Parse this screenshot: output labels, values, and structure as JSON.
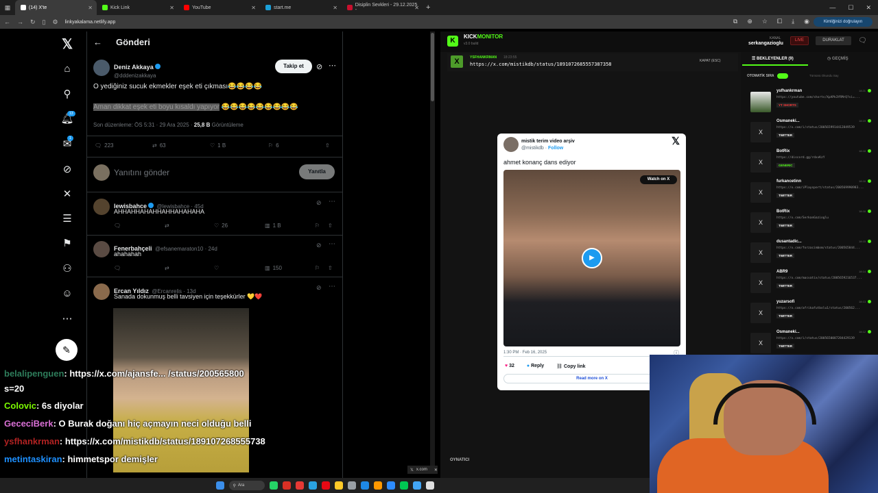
{
  "browser": {
    "tabs": [
      {
        "title": "(14) X'te",
        "color": "#ffffff",
        "active": true
      },
      {
        "title": "Kick Link",
        "color": "#53fc18",
        "active": false
      },
      {
        "title": "YouTube",
        "color": "#ff0000",
        "active": false
      },
      {
        "title": "start.me",
        "color": "#1ba0d8",
        "active": false
      },
      {
        "title": "Disiplin Sevkleri - 29.12.2025 -",
        "color": "#c8102e",
        "active": false
      }
    ],
    "url": "linkyakalama.netlify.app",
    "verify_label": "Kimliğinizi doğrulayın"
  },
  "x": {
    "header_title": "Gönderi",
    "nav_badges": {
      "notifications": "13",
      "messages": "1"
    },
    "post": {
      "author": "Deniz Akkaya",
      "handle": "@dddenizakkaya",
      "follow_label": "Takip et",
      "line1": "O yediğiniz sucuk ekmekler eşek eti çıkması😂😂😂😂",
      "line2_highlight": "Aman dikkat eşek eti boyu kısaldı yapıyor",
      "line2_rest": " 😂😂😂😂😂😂😂😂😂",
      "edited": "Son düzenleme: ÖS 5:31 · 29 Ara 2025 ·",
      "views_count": "25,8 B",
      "views_label": "Görüntüleme",
      "replies": "223",
      "reposts": "63",
      "likes": "1 B",
      "bookmarks": "6"
    },
    "reply_placeholder": "Yanıtını gönder",
    "reply_button": "Yanıtla",
    "replies": [
      {
        "name": "lewisbahce",
        "handle": "@lewisbahce · 45d",
        "text": "AHHAHHAHAHHAHHAHAHAHA",
        "likes": "26",
        "views": "1 B"
      },
      {
        "name": "Fenerbahçeli",
        "handle": "@efsanemaraton10 · 24d",
        "text": "ahahahah",
        "likes": "",
        "views": "150"
      },
      {
        "name": "Ercan Yıldız",
        "handle": "@Ercanrelis · 13d",
        "text": "Sanada dokunmuş belli tavsiyen için teşekkürler 💛❤️"
      }
    ]
  },
  "chat": [
    {
      "user": "belalipenguen",
      "msg": ": https://x.com/ajansfe... /status/200565800",
      "color": "#2e7d5b"
    },
    {
      "user": "",
      "msg": "s=20",
      "color": "#ffffff"
    },
    {
      "user": "Colovic",
      "msg": ": 6s diyolar",
      "color": "#7cfc00"
    },
    {
      "user": "GececiBerk",
      "msg": ": O Burak doğanı hiç açmayın neci olduğu belli",
      "color": "#da70d6"
    },
    {
      "user": "ysfhankrman",
      "msg": ": https://x.com/mistikdb/status/18910726855573​8",
      "color": "#b22222"
    },
    {
      "user": "metintaskiran",
      "msg": ": himmetspor demişler",
      "color": "#1e90ff"
    }
  ],
  "kick": {
    "title_a": "KICK",
    "title_b": "MONITOR",
    "version": "v3.0 build",
    "kanal_label": "KANAL",
    "channel": "serkangazioglu",
    "live_label": "LIVE",
    "pause_label": "DURAKLAT",
    "current": {
      "user": "YSFHANKRMAN",
      "time": "18:23:55",
      "url": "https://x.com/mistikdb/status/1891072685557387358",
      "close": "KAPAT (ESC)"
    },
    "tab_pending": "BEKLEYENLER (9)",
    "tab_history": "GEÇMİŞ",
    "auto_label": "OTOMATİK SIRA",
    "clear_label": "Tümünü Okundu Say",
    "player_label": "OYNATICI",
    "xcom_tab": "x.com",
    "queue": [
      {
        "name": "ysfhankrman",
        "url": "https://youtube.com/shorts/XpAPk3YRMrQ?si=...",
        "tag": "YT SHORTS",
        "tag_color": "#ff3b3b",
        "time": "18:21"
      },
      {
        "name": "Osmaneki...",
        "url": "https://x.com/i/status/2005659914412849539",
        "tag": "TWITTER",
        "tag_color": "#ffffff",
        "time": "18:19"
      },
      {
        "name": "BotRix",
        "url": "https://discord.gg/rdxvKzY",
        "tag": "GENERIC",
        "tag_color": "#53fc18",
        "time": "18:18"
      },
      {
        "name": "furkancetinn",
        "url": "https://x.com/iPlaysport/status/200569990983...",
        "tag": "TWITTER",
        "tag_color": "#ffffff",
        "time": "18:16"
      },
      {
        "name": "BotRix",
        "url": "https://x.com/SerkanGazioglu",
        "tag": "TWITTER",
        "tag_color": "#ffffff",
        "time": "18:16"
      },
      {
        "name": "dusantadic...",
        "url": "https://x.com/forzacimbom/status/200565844...",
        "tag": "TWITTER",
        "tag_color": "#ffffff",
        "time": "18:15"
      },
      {
        "name": "ABR9",
        "url": "https://x.com/macvatix/status/2005659216537...",
        "tag": "TWITTER",
        "tag_color": "#ffffff",
        "time": "18:14"
      },
      {
        "name": "yuzarsofi",
        "url": "https://x.com/afrikafutbolu1/status/200562...",
        "tag": "TWITTER",
        "tag_color": "#ffffff",
        "time": "18:13"
      },
      {
        "name": "Osmaneki...",
        "url": "https://x.com/i/status/2005650087284429139",
        "tag": "TWITTER",
        "tag_color": "#ffffff",
        "time": "18:12"
      }
    ]
  },
  "embed": {
    "author": "mistik terim video arşiv",
    "handle": "@mistikdb",
    "follow": "Follow",
    "text": "ahmet konanç dans ediyor",
    "watch": "Watch on X",
    "date": "1:30 PM · Feb 16, 2025",
    "likes": "32",
    "reply": "Reply",
    "copy": "Copy link",
    "readmore": "Read more on X"
  },
  "taskbar": {
    "search": "Ara"
  }
}
